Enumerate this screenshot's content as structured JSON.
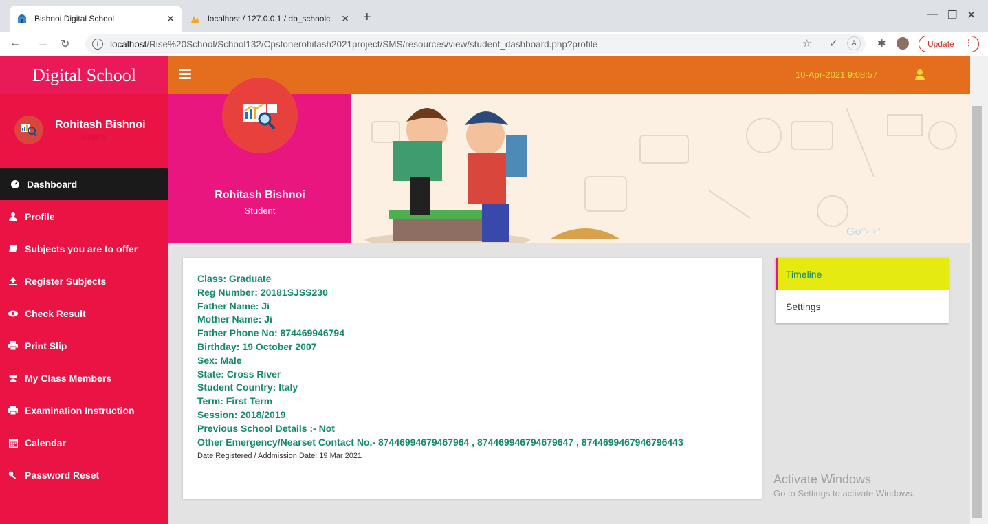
{
  "browser": {
    "tabs": [
      {
        "title": "Bishnoi Digital School",
        "icon": "school-favicon-icon",
        "active": true
      },
      {
        "title": "localhost / 127.0.0.1 / db_schoolc",
        "icon": "phpmyadmin-favicon-icon",
        "active": false
      }
    ],
    "url_host": "localhost",
    "url_path": "/Rise%20School/School132/Cpstonerohitash2021project/SMS/resources/view/student_dashboard.php?profile",
    "update_label": "Update"
  },
  "app": {
    "brand": "Digital School",
    "datetime": "10-Apr-2021 9:08:57"
  },
  "sidebar": {
    "user_name": "Rohitash Bishnoi",
    "user_role": "Student",
    "items": [
      {
        "label": "Dashboard",
        "icon": "dashboard-icon"
      },
      {
        "label": "Profile",
        "icon": "user-icon"
      },
      {
        "label": "Subjects you are to offer",
        "icon": "book-icon"
      },
      {
        "label": "Register Subjects",
        "icon": "upload-icon"
      },
      {
        "label": "Check Result",
        "icon": "eye-icon"
      },
      {
        "label": "Print Slip",
        "icon": "print-icon"
      },
      {
        "label": "My Class Members",
        "icon": "users-icon"
      },
      {
        "label": "Examination Instruction",
        "icon": "print-icon"
      },
      {
        "label": "Calendar",
        "icon": "calendar-icon"
      },
      {
        "label": "Password Reset",
        "icon": "key-icon"
      }
    ]
  },
  "profile_card": {
    "name": "Rohitash Bishnoi",
    "role": "Student"
  },
  "student_info": {
    "lines": [
      "Class: Graduate",
      "Reg Number: 20181SJSS230",
      "Father Name: Ji",
      "Mother Name: Ji",
      "Father Phone No: 874469946794",
      "Birthday: 19 October 2007",
      "Sex: Male",
      "State: Cross River",
      "Student Country: Italy",
      "Term: First Term",
      "Session: 2018/2019",
      "Previous School Details :- Not",
      "Other Emergency/Nearset Contact No.- 87446994679467964 , 874469946794679647 , 8744699467946796443"
    ],
    "registered_note": "Date Registered / Addmission Date: 19 Mar 2021"
  },
  "side_menu": {
    "items": [
      "Timeline",
      "Settings"
    ]
  },
  "watermark": {
    "line1": "Activate Windows",
    "line2": "Go to Settings to activate Windows."
  }
}
